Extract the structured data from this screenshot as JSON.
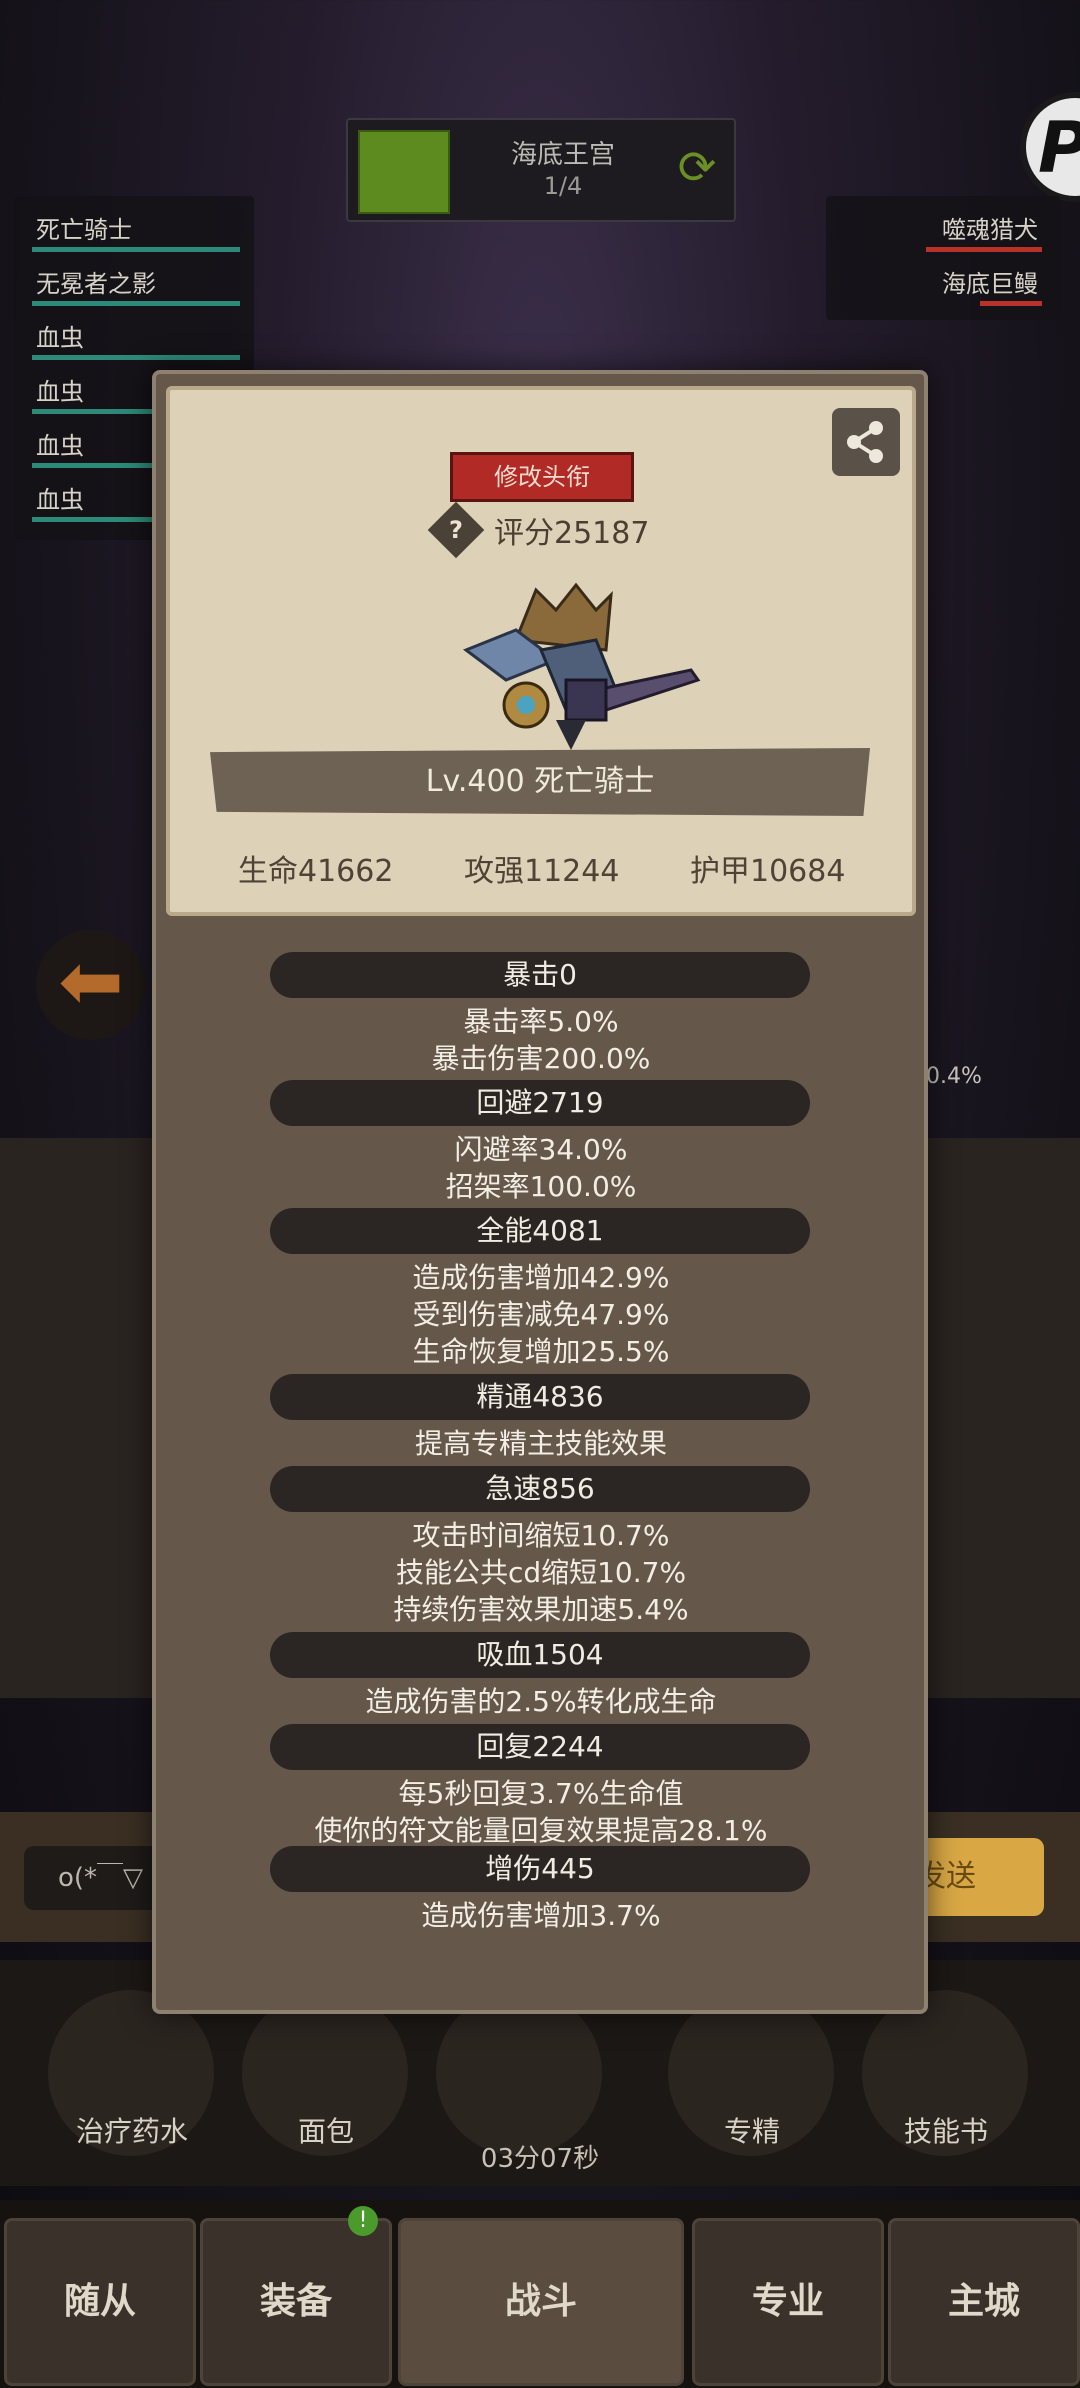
{
  "stage": {
    "name": "海底王宫",
    "progress": "1/4"
  },
  "allies": [
    "死亡骑士",
    "无冕者之影",
    "血虫",
    "血虫",
    "血虫",
    "血虫"
  ],
  "enemies": [
    "噬魂猎犬",
    "海底巨鳗"
  ],
  "side_percent": "0.4%",
  "chat": {
    "input_value": "o(*￣▽",
    "send_label": "发送"
  },
  "items": [
    {
      "label": "治疗药水"
    },
    {
      "label": "面包"
    },
    {
      "label": ""
    },
    {
      "label": "专精"
    },
    {
      "label": "技能书"
    }
  ],
  "timer": "03分07秒",
  "nav": {
    "followers": "随从",
    "equipment": "装备",
    "battle": "战斗",
    "profession": "专业",
    "main_city": "主城",
    "badge": "!"
  },
  "profile": {
    "edit_title_label": "修改头衔",
    "score_icon_char": "?",
    "score": "评分25187",
    "name": "Lv.400 死亡骑士",
    "hp": "生命41662",
    "attack": "攻强11244",
    "armor": "护甲10684"
  },
  "stats": [
    {
      "header": "暴击0",
      "lines": [
        "暴击率5.0%",
        "暴击伤害200.0%"
      ]
    },
    {
      "header": "回避2719",
      "lines": [
        "闪避率34.0%",
        "招架率100.0%"
      ]
    },
    {
      "header": "全能4081",
      "lines": [
        "造成伤害增加42.9%",
        "受到伤害减免47.9%",
        "生命恢复增加25.5%"
      ]
    },
    {
      "header": "精通4836",
      "lines": [
        "提高专精主技能效果"
      ]
    },
    {
      "header": "急速856",
      "lines": [
        "攻击时间缩短10.7%",
        "技能公共cd缩短10.7%",
        "持续伤害效果加速5.4%"
      ]
    },
    {
      "header": "吸血1504",
      "lines": [
        "造成伤害的2.5%转化成生命"
      ]
    },
    {
      "header": "回复2244",
      "lines": [
        "每5秒回复3.7%生命值",
        "使你的符文能量回复效果提高28.1%"
      ]
    },
    {
      "header": "增伤445",
      "lines": [
        "造成伤害增加3.7%"
      ]
    }
  ]
}
